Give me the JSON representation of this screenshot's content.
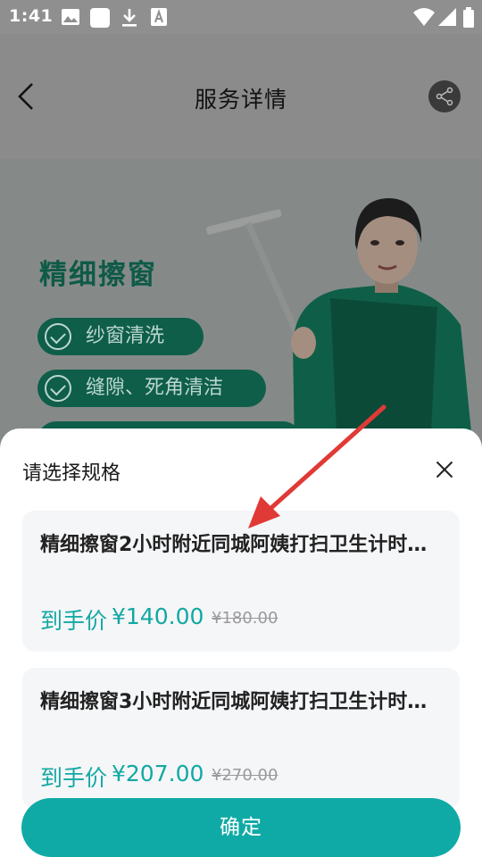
{
  "status_bar": {
    "time": "1:41"
  },
  "header": {
    "title": "服务详情"
  },
  "hero": {
    "title": "精细擦窗",
    "features": [
      "纱窗清洗",
      "缝隙、死角清洁",
      ""
    ]
  },
  "sheet": {
    "title": "请选择规格",
    "options": [
      {
        "name": "精细擦窗2小时附近同城阿姨打扫卫生计时…",
        "price_label": "到手价",
        "price": "¥140.00",
        "original_price": "¥180.00"
      },
      {
        "name": "精细擦窗3小时附近同城阿姨打扫卫生计时…",
        "price_label": "到手价",
        "price": "¥207.00",
        "original_price": "¥270.00"
      }
    ],
    "confirm_label": "确定"
  },
  "colors": {
    "accent": "#10aaa6",
    "price": "#12a8a3",
    "annotation_arrow": "#e03a36"
  }
}
